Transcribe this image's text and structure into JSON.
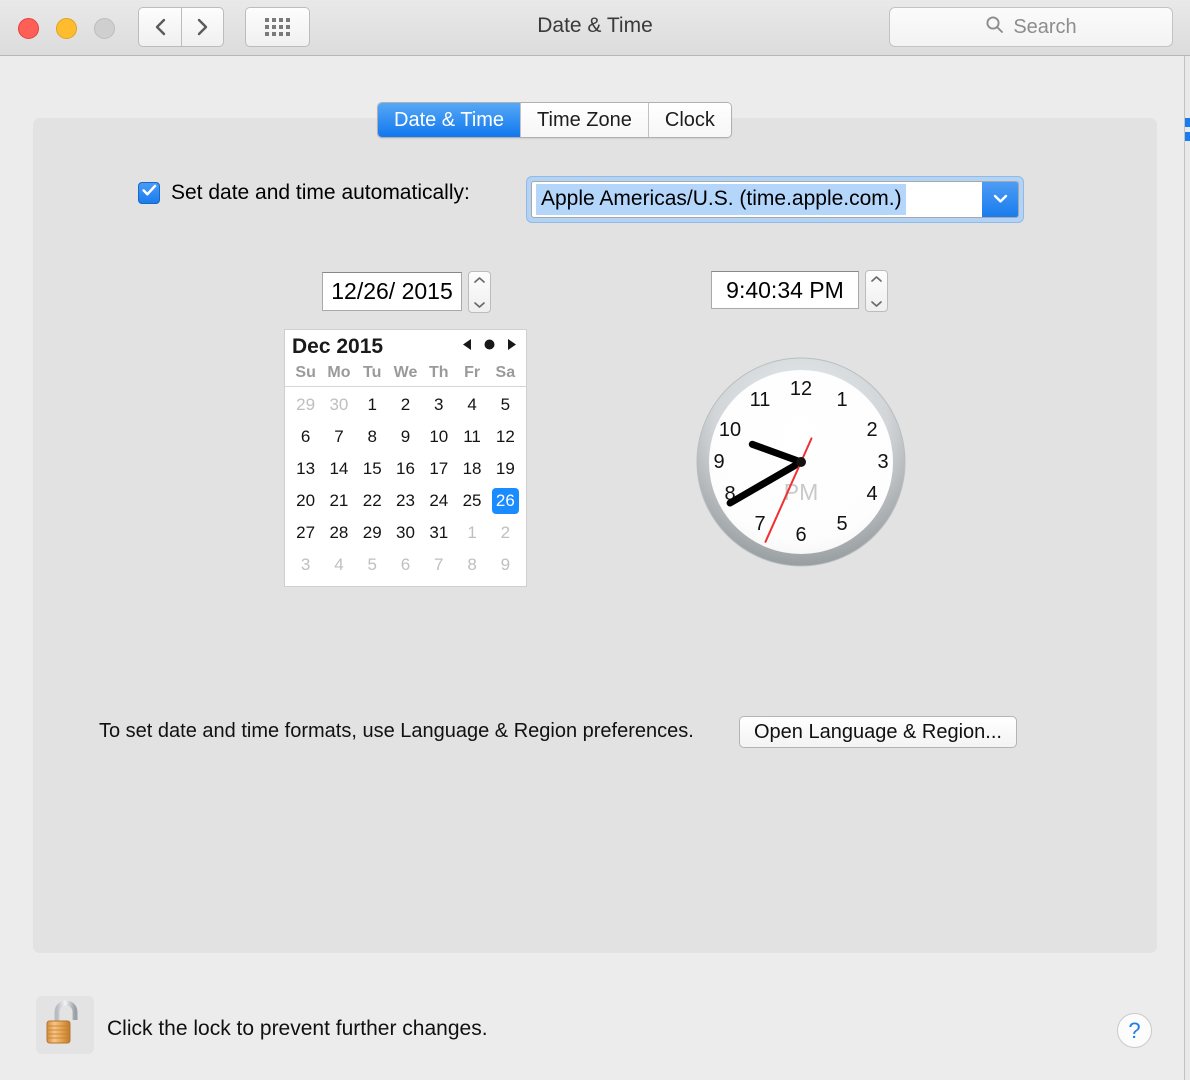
{
  "window": {
    "title": "Date & Time",
    "traffic_lights": [
      "close",
      "minimize",
      "zoom"
    ],
    "back_icon": "chevron-left-icon",
    "forward_icon": "chevron-right-icon",
    "grid_icon": "show-all-grid-icon"
  },
  "search": {
    "placeholder": "Search",
    "icon": "search-icon"
  },
  "tabs": [
    {
      "label": "Date & Time",
      "active": true
    },
    {
      "label": "Time Zone",
      "active": false
    },
    {
      "label": "Clock",
      "active": false
    }
  ],
  "auto": {
    "checked": true,
    "check_icon": "checkmark-icon",
    "label": "Set date and time automatically:",
    "server_value": "Apple Americas/U.S. (time.apple.com.)",
    "dropdown_icon": "chevron-down-icon"
  },
  "date_field": {
    "value": "12/26/ 2015",
    "stepper_up_icon": "chevron-up-icon",
    "stepper_down_icon": "chevron-down-icon"
  },
  "time_field": {
    "value": "9:40:34 PM",
    "stepper_up_icon": "chevron-up-icon",
    "stepper_down_icon": "chevron-down-icon"
  },
  "calendar": {
    "title": "Dec 2015",
    "prev_icon": "triangle-left-icon",
    "today_icon": "dot-icon",
    "next_icon": "triangle-right-icon",
    "weekdays": [
      "Su",
      "Mo",
      "Tu",
      "We",
      "Th",
      "Fr",
      "Sa"
    ],
    "selected_day": 26,
    "weeks": [
      [
        {
          "d": "29",
          "dim": true
        },
        {
          "d": "30",
          "dim": true
        },
        {
          "d": "1",
          "dim": false
        },
        {
          "d": "2",
          "dim": false
        },
        {
          "d": "3",
          "dim": false
        },
        {
          "d": "4",
          "dim": false
        },
        {
          "d": "5",
          "dim": false
        }
      ],
      [
        {
          "d": "6",
          "dim": false
        },
        {
          "d": "7",
          "dim": false
        },
        {
          "d": "8",
          "dim": false
        },
        {
          "d": "9",
          "dim": false
        },
        {
          "d": "10",
          "dim": false
        },
        {
          "d": "11",
          "dim": false
        },
        {
          "d": "12",
          "dim": false
        }
      ],
      [
        {
          "d": "13",
          "dim": false
        },
        {
          "d": "14",
          "dim": false
        },
        {
          "d": "15",
          "dim": false
        },
        {
          "d": "16",
          "dim": false
        },
        {
          "d": "17",
          "dim": false
        },
        {
          "d": "18",
          "dim": false
        },
        {
          "d": "19",
          "dim": false
        }
      ],
      [
        {
          "d": "20",
          "dim": false
        },
        {
          "d": "21",
          "dim": false
        },
        {
          "d": "22",
          "dim": false
        },
        {
          "d": "23",
          "dim": false
        },
        {
          "d": "24",
          "dim": false
        },
        {
          "d": "25",
          "dim": false
        },
        {
          "d": "26",
          "dim": false,
          "selected": true
        }
      ],
      [
        {
          "d": "27",
          "dim": false
        },
        {
          "d": "28",
          "dim": false
        },
        {
          "d": "29",
          "dim": false
        },
        {
          "d": "30",
          "dim": false
        },
        {
          "d": "31",
          "dim": false
        },
        {
          "d": "1",
          "dim": true
        },
        {
          "d": "2",
          "dim": true
        }
      ],
      [
        {
          "d": "3",
          "dim": true
        },
        {
          "d": "4",
          "dim": true
        },
        {
          "d": "5",
          "dim": true
        },
        {
          "d": "6",
          "dim": true
        },
        {
          "d": "7",
          "dim": true
        },
        {
          "d": "8",
          "dim": true
        },
        {
          "d": "9",
          "dim": true
        }
      ]
    ]
  },
  "clock": {
    "meridiem": "PM",
    "hour_numbers": [
      "12",
      "1",
      "2",
      "3",
      "4",
      "5",
      "6",
      "7",
      "8",
      "9",
      "10",
      "11"
    ],
    "hour": 9,
    "minute": 40,
    "second": 34,
    "hour_hand_deg": 290,
    "minute_hand_deg": 240,
    "second_hand_deg": 204,
    "second_hand_color": "#f03030"
  },
  "formats": {
    "text": "To set date and time formats, use Language & Region preferences.",
    "button_label": "Open Language & Region..."
  },
  "footer": {
    "lock_icon": "unlocked-padlock-icon",
    "lock_text": "Click the lock to prevent further changes.",
    "help_label": "?"
  },
  "colors": {
    "accent_blue": "#1a7ced",
    "selection_blue": "#1a8cff",
    "window_bg": "#ececec",
    "panel_bg": "#e2e2e2"
  }
}
